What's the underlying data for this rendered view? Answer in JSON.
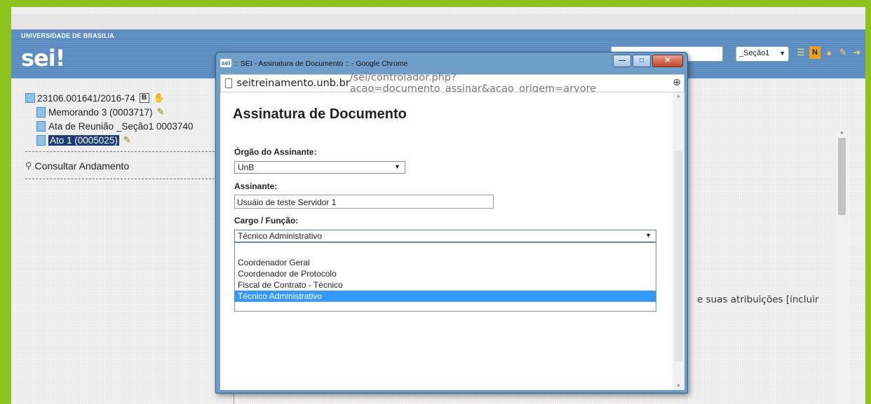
{
  "header": {
    "university": "UNIVERSIDADE DE BRASILIA",
    "logo": "sei!",
    "unit_select": "_Seção1",
    "icons": [
      "list-icon",
      "notes-icon",
      "user-icon",
      "tools-icon",
      "exit-icon"
    ]
  },
  "tree": {
    "process": "23106.001641/2016-74",
    "process_badge": "B",
    "documents": [
      {
        "label": "Memorando 3 (0003717)"
      },
      {
        "label": "Ata de Reunião _Seção1 0003740"
      },
      {
        "label": "Ato 1 (0005025)"
      }
    ],
    "consult": "Consultar Andamento"
  },
  "main": {
    "body_fragment": "e suas atribuições [incluir"
  },
  "popup": {
    "window_title": ":: SEI - Assinatura de Documento :: - Google Chrome",
    "chrome_logo": "sei",
    "address_host": "seitreinamento.unb.br",
    "address_path": "/sei/controlador.php?acao=documento_assinar&acao_origem=arvore_",
    "form_title": "Assinatura de Documento",
    "orgao_label": "Órgão do Assinante:",
    "orgao_value": "UnB",
    "assinante_label": "Assinante:",
    "assinante_value": "Usuáio de teste Servidor 1",
    "cargo_label": "Cargo / Função:",
    "cargo_value": "Técnico Administrativo",
    "cargo_options": [
      "Coordenador Geral",
      "Coordenador de Protocolo",
      "Fiscal de Contrato - Técnico",
      "Técnico Administrativo"
    ],
    "selected_option": "Técnico Administrativo"
  },
  "colors": {
    "frame_green": "#8dc21f",
    "header_blue": "#5b8ac0",
    "selection_blue": "#3399ff"
  }
}
